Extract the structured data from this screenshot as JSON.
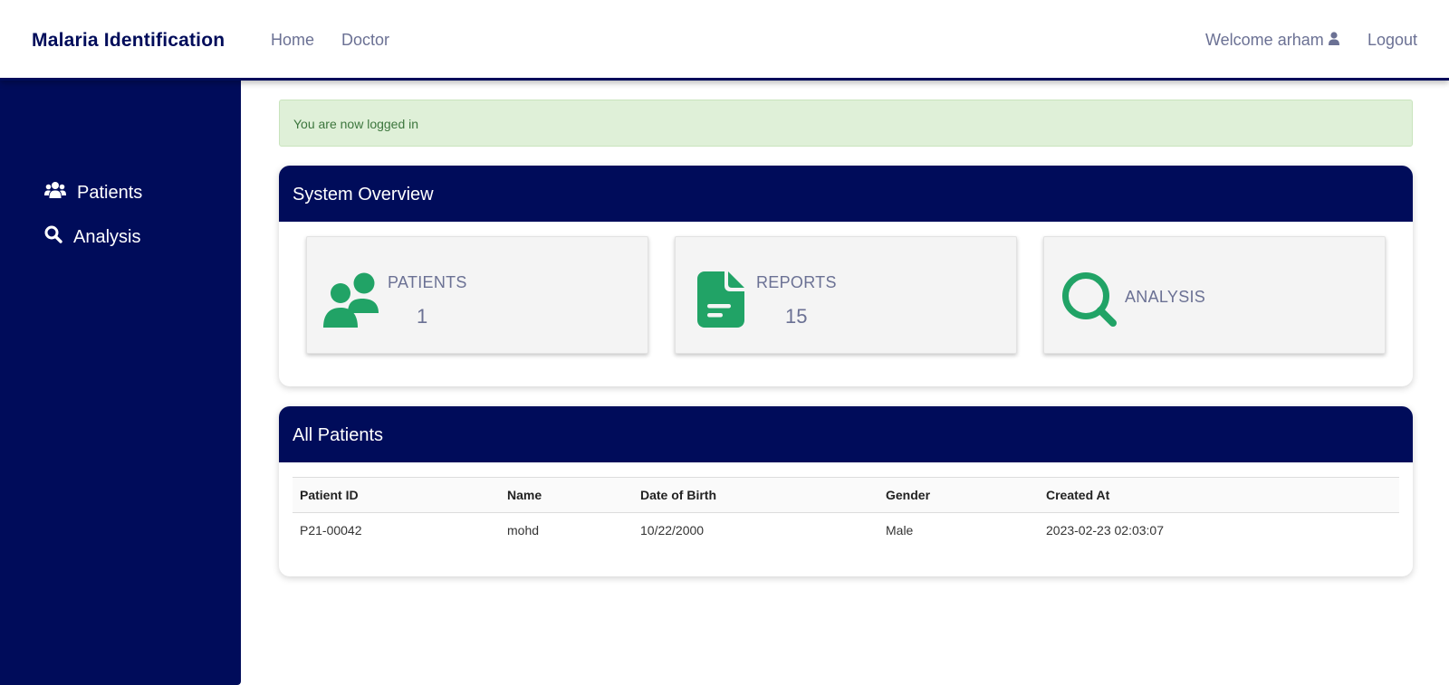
{
  "navbar": {
    "brand": "Malaria Identification",
    "links": {
      "home": "Home",
      "doctor": "Doctor"
    },
    "welcome": "Welcome arham",
    "logout": "Logout"
  },
  "sidebar": {
    "items": [
      {
        "label": "Patients",
        "icon": "users-icon"
      },
      {
        "label": "Analysis",
        "icon": "search-icon"
      }
    ]
  },
  "alert": {
    "message": "You are now logged in"
  },
  "overview": {
    "title": "System Overview",
    "stats": [
      {
        "label": "PATIENTS",
        "value": "1",
        "icon": "users-icon"
      },
      {
        "label": "REPORTS",
        "value": "15",
        "icon": "file-icon"
      },
      {
        "label": "ANALYSIS",
        "value": "",
        "icon": "search-icon"
      }
    ]
  },
  "patients": {
    "title": "All Patients",
    "columns": [
      "Patient ID",
      "Name",
      "Date of Birth",
      "Gender",
      "Created At"
    ],
    "rows": [
      [
        "P21-00042",
        "mohd",
        "10/22/2000",
        "Male",
        "2023-02-23 02:03:07"
      ]
    ]
  },
  "colors": {
    "primary": "#000c5a",
    "accent": "#21a366",
    "muted_text": "#6b7194",
    "alert_bg": "#dff0d8"
  }
}
